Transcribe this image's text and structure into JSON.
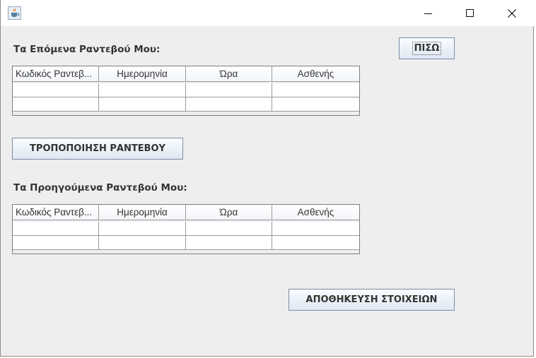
{
  "window": {
    "title": ""
  },
  "upcoming": {
    "heading": "Τα Επόμενα Ραντεβού Μου:",
    "columns": [
      "Κωδικός Ραντεβ...",
      "Ημερομηνία",
      "Ώρα",
      "Ασθενής"
    ],
    "rows": [
      [
        "",
        "",
        "",
        ""
      ],
      [
        "",
        "",
        "",
        ""
      ]
    ]
  },
  "previous": {
    "heading": "Τα Προηγούμενα Ραντεβού Μου:",
    "columns": [
      "Κωδικός Ραντεβ...",
      "Ημερομηνία",
      "Ώρα",
      "Ασθενής"
    ],
    "rows": [
      [
        "",
        "",
        "",
        ""
      ],
      [
        "",
        "",
        "",
        ""
      ]
    ]
  },
  "buttons": {
    "back": "ΠΙΣΩ",
    "modify": "ΤΡΟΠΟΠΟΙΗΣΗ ΡΑΝΤΕΒΟΥ",
    "save": "ΑΠΟΘΗΚΕΥΣΗ ΣΤΟΙΧΕΙΩΝ"
  },
  "icons": {
    "app": "java-cup-icon",
    "minimize": "minimize-icon",
    "maximize": "maximize-icon",
    "close": "close-icon"
  }
}
